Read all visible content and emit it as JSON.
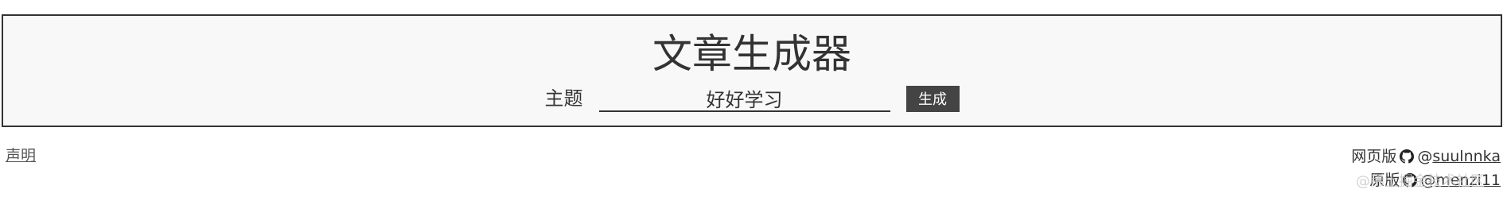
{
  "header": {
    "title": "文章生成器"
  },
  "form": {
    "topic_label": "主题",
    "topic_value": "好好学习",
    "generate_label": "生成"
  },
  "footer": {
    "disclaimer_label": "声明",
    "credits": [
      {
        "label": "网页版",
        "icon": "github-icon",
        "at": "@",
        "handle": "suulnnka"
      },
      {
        "label": "原版",
        "icon": "github-icon",
        "at": "@",
        "handle": "menzi11"
      }
    ],
    "watermark": "@稀土掘金技术社区"
  },
  "colors": {
    "panel_bg": "#f8f8f8",
    "border": "#333333",
    "button_bg": "#444444",
    "button_text": "#ffffff"
  }
}
